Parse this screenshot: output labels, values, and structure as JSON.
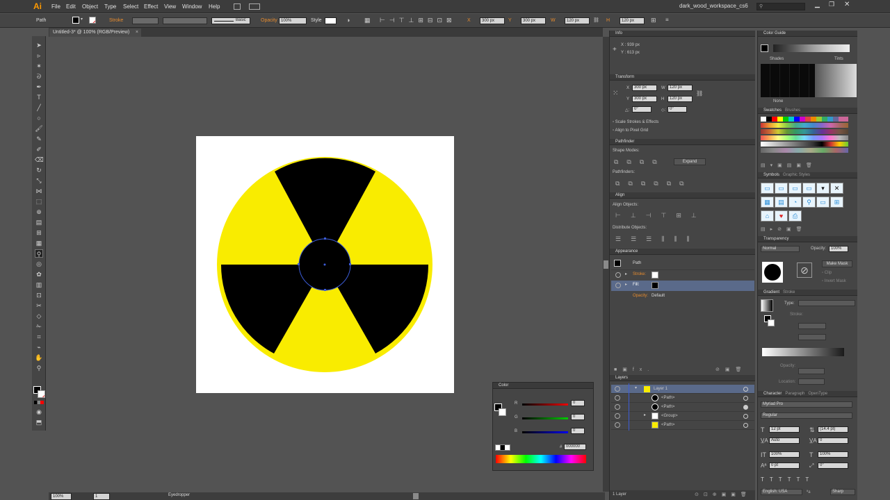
{
  "app": {
    "logo": "Ai",
    "workspace": "dark_wood_workspace_cs6"
  },
  "menu": [
    "File",
    "Edit",
    "Object",
    "Type",
    "Select",
    "Effect",
    "View",
    "Window",
    "Help"
  ],
  "control": {
    "selection": "Path",
    "stroke_label": "Stroke",
    "brush": "Basic",
    "opacity_label": "Opacity",
    "opacity": "100%",
    "style_label": "Style",
    "x_label": "X",
    "x": "300 px",
    "y_label": "Y",
    "y": "300 px",
    "w_label": "W",
    "w": "120 px",
    "h_label": "H",
    "h": "120 px"
  },
  "document": {
    "tab": "Untitled-3* @ 100% (RGB/Preview)"
  },
  "info": {
    "title": "Info",
    "x": "X : 939 px",
    "y": "Y : 613 px"
  },
  "transform": {
    "title": "Transform",
    "x_label": "X",
    "x": "300 px",
    "y_label": "Y",
    "y": "300 px",
    "w_label": "W",
    "w": "120 px",
    "h_label": "H",
    "h": "120 px",
    "rotate": "0°",
    "shear": "0°",
    "scale_strokes": "Scale Strokes & Effects",
    "align_pixel": "Align to Pixel Grid"
  },
  "pathfinder": {
    "title": "Pathfinder",
    "shape_modes": "Shape Modes:",
    "expand": "Expand",
    "pathfinders": "Pathfinders:"
  },
  "align": {
    "title": "Align",
    "align_objects": "Align Objects:",
    "distribute_objects": "Distribute Objects:"
  },
  "appearance": {
    "title": "Appearance",
    "path": "Path",
    "stroke": "Stroke:",
    "fill": "Fill:",
    "opacity_label": "Opacity:",
    "opacity": "Default"
  },
  "layers": {
    "title": "Layers",
    "rows": [
      {
        "name": "Layer 1"
      },
      {
        "name": "<Path>"
      },
      {
        "name": "<Path>"
      },
      {
        "name": "<Group>"
      },
      {
        "name": "<Path>"
      }
    ],
    "footer": "1 Layer"
  },
  "color_guide": {
    "title": "Color Guide",
    "shades": "Shades",
    "tints": "Tints",
    "none": "None"
  },
  "swatches": {
    "title": "Swatches",
    "tab2": "Brushes"
  },
  "symbols": {
    "title": "Symbols",
    "tab2": "Graphic Styles"
  },
  "transparency": {
    "title": "Transparency",
    "mode": "Normal",
    "opacity_label": "Opacity:",
    "opacity": "100%",
    "make_mask": "Make Mask",
    "clip": "Clip",
    "invert_mask": "Invert Mask"
  },
  "gradient": {
    "title": "Gradient",
    "tab2": "Stroke",
    "type_label": "Type:",
    "stroke_label": "Stroke:",
    "opacity_label": "Opacity:",
    "location_label": "Location:"
  },
  "character": {
    "title": "Character",
    "tab2": "Paragraph",
    "tab3": "OpenType",
    "font": "Myriad Pro",
    "style": "Regular",
    "size": "12 pt",
    "leading": "(14.4 pt)",
    "kerning": "Auto",
    "tracking": "0",
    "vscale": "100%",
    "hscale": "100%",
    "baseline": "0 pt",
    "rotation": "0°",
    "lang": "English: USA",
    "aa": "Sharp"
  },
  "color_panel": {
    "title": "Color",
    "r_label": "R",
    "r": "0",
    "g_label": "G",
    "g": "0",
    "b_label": "B",
    "b": "0",
    "hex_label": "#",
    "hex": "000000"
  },
  "status": {
    "zoom": "100%",
    "page": "1",
    "tool": "Eyedropper"
  },
  "colors": {
    "yellow": "#f9ec00",
    "black": "#000000",
    "selection": "#3c5cd8"
  }
}
